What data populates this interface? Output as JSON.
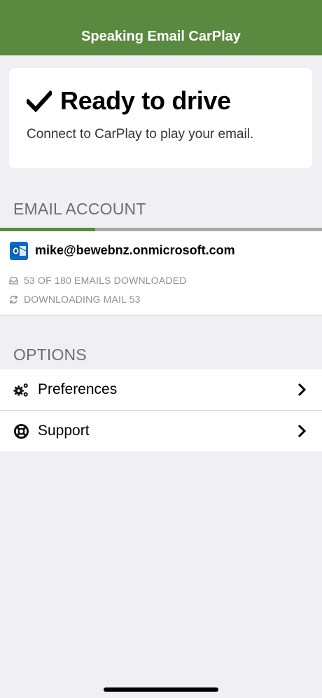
{
  "nav": {
    "title": "Speaking Email CarPlay"
  },
  "ready": {
    "title": "Ready to drive",
    "subtitle": "Connect to CarPlay to play your email.",
    "icon": "checkmark-icon"
  },
  "email_section": {
    "header": "EMAIL ACCOUNT"
  },
  "account": {
    "email": "mike@bewebnz.onmicrosoft.com",
    "icon": "outlook-icon",
    "progress_fraction": 0.295,
    "downloaded_text": "53 OF 180 EMAILS DOWNLOADED",
    "downloading_text": "DOWNLOADING MAIL 53"
  },
  "options_section": {
    "header": "OPTIONS",
    "items": [
      {
        "label": "Preferences",
        "icon": "gears-icon"
      },
      {
        "label": "Support",
        "icon": "lifebuoy-icon"
      }
    ]
  },
  "colors": {
    "brand_green": "#5a8a3f",
    "outlook_blue": "#0a6ac4"
  }
}
